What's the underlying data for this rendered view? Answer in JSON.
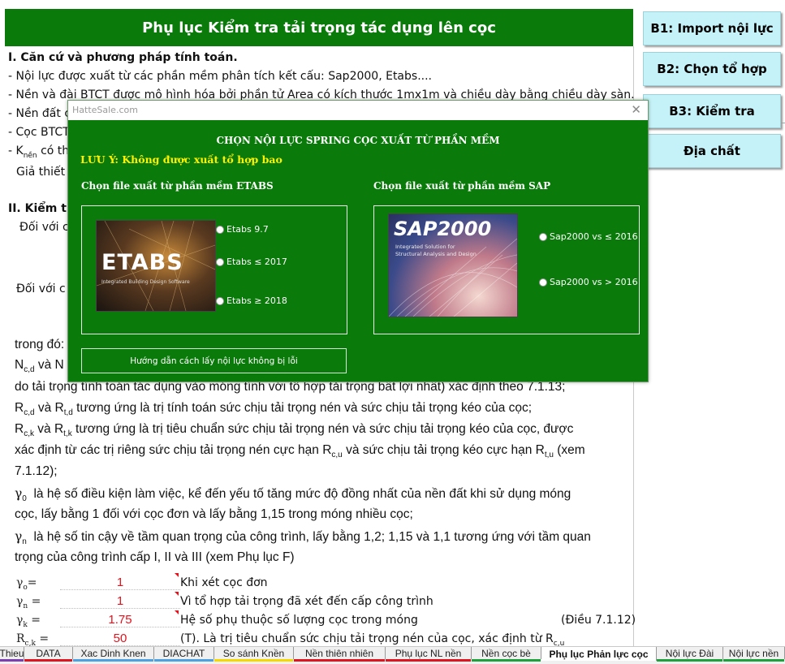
{
  "sheet": {
    "title": "Phụ lục Kiểm tra tải trọng tác dụng lên cọc",
    "section1_heading": "I. Căn cứ và phương pháp tính toán.",
    "lines": [
      "- Nội lực được xuất từ các phần mềm phân tích kết cấu: Sap2000, Etabs....",
      "- Nền và đài BTCT được mô hình hóa bởi phần tử Area có kích thước 1mx1m và chiều dày bằng chiều dày sàn.",
      "- Nền đất c",
      "- Cọc BTCT",
      "- K",
      "nền",
      " có th",
      "Giả thiết"
    ],
    "section2_heading": "II. Kiểm tr",
    "doi_voi_1": "Đối với c",
    "doi_voi_2": "Đối với c",
    "trong_do": "trong đó:",
    "ncd": "N",
    "ncd_sub": "c,d",
    "ncd_rest": "và N",
    "body": [
      "do tải trọng tính toán tác dụng vào móng tính với tổ hợp tải trọng bất lợi nhất) xác định theo 7.1.13;",
      "tương ứng là trị tính toán sức chịu tải trọng nén và sức chịu tải trọng kéo của cọc;",
      "tương ứng là trị tiêu chuẩn sức chịu tải trọng nén và sức chịu tải trọng kéo của cọc, được",
      "xác định từ các trị riêng sức chịu tải trọng nén cực hạn R",
      "và sức chịu tải trọng kéo cực hạn R",
      "(xem",
      "7.1.12);",
      "là hệ số điều kiện làm việc, kể đến yếu tố tăng mức độ đồng nhất của nền đất khi sử dụng móng",
      "cọc, lấy bằng 1 đối với cọc đơn và lấy bằng 1,15 trong móng nhiều cọc;",
      "là hệ số tin cậy về tầm quan trọng của công trình, lấy bằng 1,2; 1,15 và 1,1 tương ứng với tầm quan",
      "trọng của công trình cấp I, II và III (xem Phụ lục F)"
    ],
    "r_labels": {
      "rcd": "R",
      "rcd_sub": "c,d",
      "va": "và R",
      "rtd_sub": "t,d",
      "rck": "R",
      "rck_sub": "c,k",
      "rtk_sub": "t,k",
      "rcu_sub": "c,u",
      "rtu_sub": "t,u"
    },
    "gamma": "γ",
    "gamma0_sub": "0",
    "gamman_sub": "n",
    "params": [
      {
        "sym": "γ",
        "sub": "o",
        "eq": "=",
        "value": "1",
        "desc": "Khi xét cọc đơn",
        "note": ""
      },
      {
        "sym": "γ",
        "sub": "n",
        "eq": "=",
        "value": "1",
        "desc": "Vì tổ hợp tải trọng đã xét đến cấp công trình",
        "note": ""
      },
      {
        "sym": "γ",
        "sub": "k",
        "eq": "=",
        "value": "1.75",
        "desc": "Hệ số phụ thuộc số lượng cọc trong móng",
        "note": "(Điều 7.1.12)"
      },
      {
        "sym": "R",
        "sub": "c,k",
        "eq": "=",
        "value": "50",
        "desc": "(T). Là trị tiêu chuẩn sức chịu tải trọng nén của cọc, xác định từ R",
        "desc_sub": "c,u",
        "note": ""
      }
    ]
  },
  "side_buttons": [
    {
      "label": "B1: Import nội lực"
    },
    {
      "label": "B2: Chọn tổ hợp"
    },
    {
      "label": "B3: Kiểm tra"
    },
    {
      "label": "Địa chất"
    }
  ],
  "dialog": {
    "window_title": "HatteSale.com",
    "close": "✕",
    "heading": "CHỌN NỘI LỰC SPRING CỌC XUẤT TỪ PHẦN MỀM",
    "warning": "LƯU Ý: Không được  xuất tổ hợp bao",
    "etabs_group_label": "Chọn file xuất từ phần mềm ETABS",
    "sap_group_label": "Chọn file xuất từ phần mềm SAP",
    "etabs_logo_text": "ETABS",
    "etabs_logo_sub": "Integrated Building Design Software",
    "sap_logo_text": "SAP2000",
    "sap_logo_sub1": "Integrated Solution for",
    "sap_logo_sub2": "Structural Analysis and Design",
    "etabs_options": [
      "Etabs 9.7",
      "Etabs ≤  2017",
      "Etabs ≥  2018"
    ],
    "sap_options": [
      "Sap2000 vs ≤ 2016",
      "Sap2000 vs > 2016"
    ],
    "guide_button": "Hướng dẫn cách lấy nội lực không bị lỗi"
  },
  "tabs": [
    {
      "label": "Thieu",
      "active": false,
      "color": "#7b3fb1"
    },
    {
      "label": "DATA",
      "active": false,
      "color": "#e0141e"
    },
    {
      "label": "Xac Dinh Knen",
      "active": false,
      "color": "#4ea1e0"
    },
    {
      "label": "DIACHAT",
      "active": false,
      "color": "#4ea1e0"
    },
    {
      "label": "So sánh Knền",
      "active": false,
      "color": "#f5d800"
    },
    {
      "label": "Nền thiên nhiên",
      "active": false,
      "color": "#e0141e"
    },
    {
      "label": "Phụ lục NL nền",
      "active": false,
      "color": "#e0141e"
    },
    {
      "label": "Nền cọc bè",
      "active": false,
      "color": "#1ea03c"
    },
    {
      "label": "Phụ lục Phản lực cọc",
      "active": true,
      "color": "#1ea03c"
    },
    {
      "label": "Nội lực Đài",
      "active": false,
      "color": "#1ea03c"
    },
    {
      "label": "Nội lực nền",
      "active": false,
      "color": "#1ea03c"
    }
  ]
}
